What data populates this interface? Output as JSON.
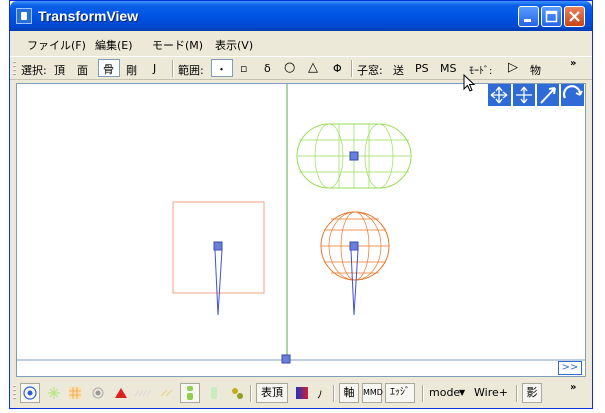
{
  "window": {
    "title": "TransformView",
    "app_icon": "app-icon",
    "controls": [
      "minimize-icon",
      "maximize-icon",
      "close-icon"
    ]
  },
  "menu": {
    "items": [
      "ファイル(F)",
      "編集(E)",
      "モード(M)",
      "表示(V)"
    ]
  },
  "toolbar": {
    "select_label": "選択:",
    "vertex": "頂",
    "face": "面",
    "bone": "骨",
    "rigid": "剛",
    "joint": "J",
    "range_label": "範囲:",
    "range_point": "・",
    "range_small_square": "▫",
    "range_delta": "δ",
    "range_circle": "○",
    "range_triangle": "△",
    "range_phi": "Φ",
    "child_window_label": "子窓:",
    "send": "送",
    "ps": "PS",
    "ms": "MS",
    "mode_label": "ﾓｰﾄﾞ:",
    "play": "▷",
    "object": "物",
    "overflow": "»"
  },
  "bottom_toolbar": {
    "table_vertex": "表頂",
    "no": "ﾉ",
    "axis": "軸",
    "mmd": "MMD",
    "edge": "ｴｯｼﾞ",
    "mode": "mode",
    "wire": "Wire+",
    "shadow": "影",
    "expand": ">>",
    "overflow": "»"
  },
  "colors": {
    "titlebar": "#0054e3",
    "box": "#f0a080",
    "capsule": "#99dd55",
    "sphere": "#e8762a",
    "bone": "#4050d0",
    "axis": "#55aa55",
    "handle": "#5570d8"
  }
}
